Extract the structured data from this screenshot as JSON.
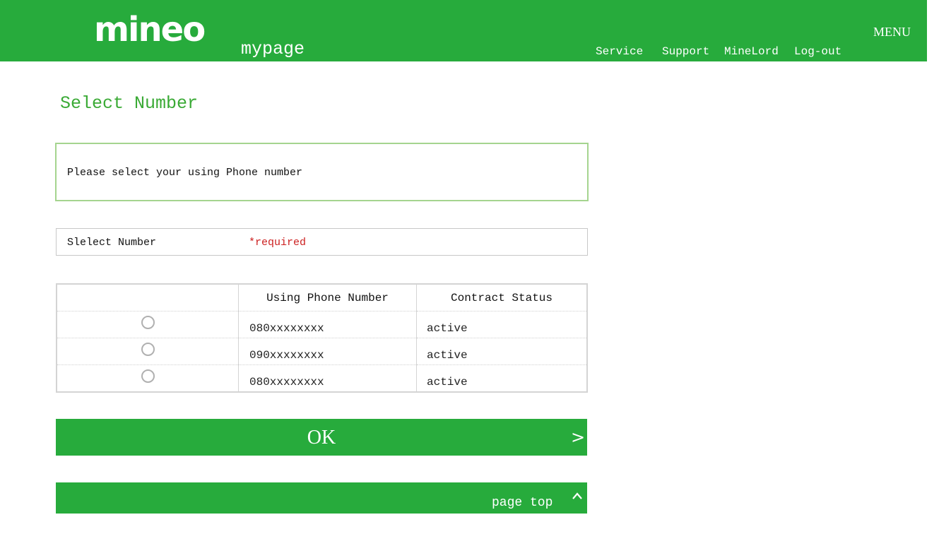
{
  "header": {
    "logo_text": "mineo",
    "subtitle": "mypage",
    "menu_label": "MENU",
    "nav": {
      "service": "Service",
      "support": "Support",
      "minelord": "MineLord",
      "logout": "Log-out"
    }
  },
  "page": {
    "title": "Select Number",
    "notice": "Please select your using Phone number",
    "select_label": "Slelect Number",
    "required_label": "*required"
  },
  "table": {
    "headers": [
      "",
      "Using Phone Number",
      "Contract Status"
    ],
    "rows": [
      {
        "number": "080xxxxxxxx",
        "status": "active",
        "selected": false
      },
      {
        "number": "090xxxxxxxx",
        "status": "active",
        "selected": false
      },
      {
        "number": "080xxxxxxxx",
        "status": "active",
        "selected": false
      }
    ]
  },
  "actions": {
    "ok_label": "OK",
    "ok_arrow": ">",
    "page_top_label": "page top",
    "page_top_icon": "chevron-up-icon"
  },
  "colors": {
    "brand_green": "#27ab3c",
    "title_green": "#3aaa35",
    "notice_border": "#a5d48f",
    "required_red": "#cc1f1f"
  }
}
